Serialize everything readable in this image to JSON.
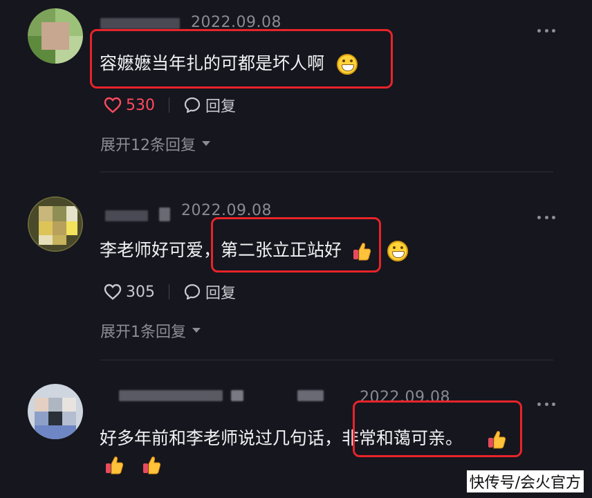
{
  "comments": [
    {
      "date": "2022.09.08",
      "text_a": "容嬷嬷当年扎的可都是坏人啊",
      "likes": "530",
      "reply_label": "回复",
      "expand_label": "展开12条回复"
    },
    {
      "date": "2022.09.08",
      "text_a": "李老师好可爱，",
      "text_b": "第二张立正站好",
      "likes": "305",
      "reply_label": "回复",
      "expand_label": "展开1条回复"
    },
    {
      "date": "2022.09.08",
      "text_a": "好多年前和李老师说过几句话，",
      "text_b": "非常和蔼可亲。"
    }
  ],
  "watermark": "快传号/会火官方",
  "colors": {
    "background": "#16161e",
    "highlight": "#e8242a",
    "liked": "#ff4a5f"
  },
  "icons": [
    "grin-emoji-icon",
    "thumbs-up-emoji-icon",
    "heart-icon",
    "comment-bubble-icon",
    "caret-down-icon",
    "more-icon"
  ]
}
